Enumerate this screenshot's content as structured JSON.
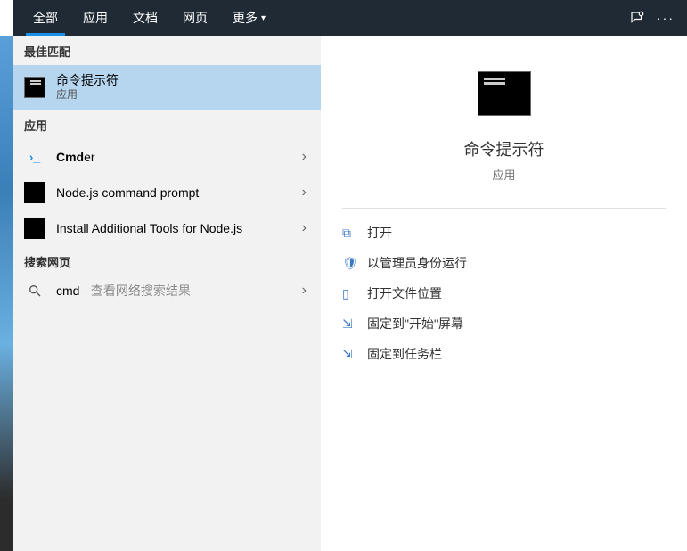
{
  "tabs": {
    "all": "全部",
    "apps": "应用",
    "docs": "文档",
    "web": "网页",
    "more": "更多"
  },
  "sections": {
    "best": "最佳匹配",
    "apps": "应用",
    "web": "搜索网页"
  },
  "best_match": {
    "title": "命令提示符",
    "sub": "应用"
  },
  "app_results": [
    {
      "title_bold": "Cmd",
      "title_rest": "er"
    },
    {
      "title": "Node.js command prompt"
    },
    {
      "title": "Install Additional Tools for Node.js"
    }
  ],
  "web_result": {
    "query": "cmd",
    "hint": " - 查看网络搜索结果"
  },
  "preview": {
    "title": "命令提示符",
    "sub": "应用"
  },
  "actions": {
    "open": "打开",
    "admin": "以管理员身份运行",
    "location": "打开文件位置",
    "pin_start": "固定到\"开始\"屏幕",
    "pin_taskbar": "固定到任务栏"
  }
}
